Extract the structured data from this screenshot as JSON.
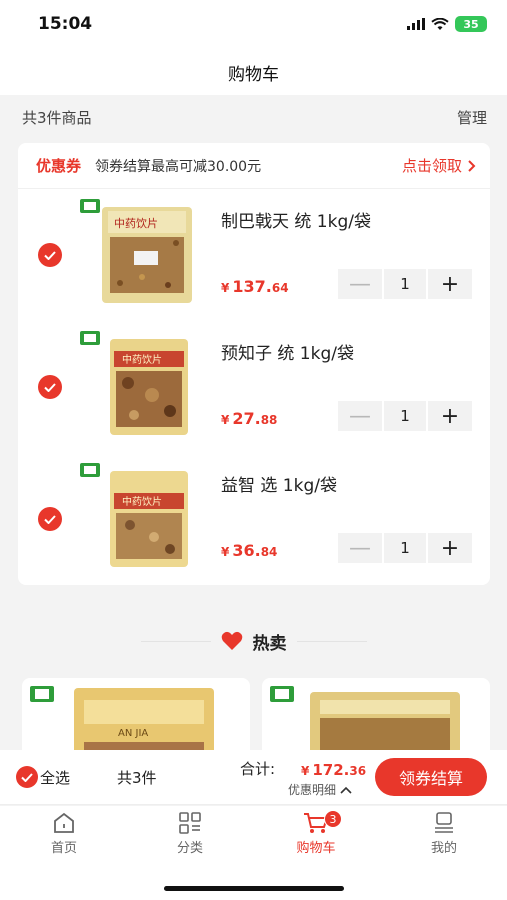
{
  "status": {
    "time": "15:04",
    "battery": "35"
  },
  "nav": {
    "title": "购物车"
  },
  "summary": {
    "count_text": "共3件商品",
    "manage": "管理"
  },
  "coupon": {
    "tag": "优惠券",
    "text": "领券结算最高可减30.00元",
    "link": "点击领取"
  },
  "items": [
    {
      "title": "制巴戟天 统 1kg/袋",
      "currency": "¥",
      "price_int": "137.",
      "price_dec": "64",
      "qty": "1",
      "selected": true
    },
    {
      "title": "预知子 统 1kg/袋",
      "currency": "¥",
      "price_int": "27.",
      "price_dec": "88",
      "qty": "1",
      "selected": true
    },
    {
      "title": "益智 选 1kg/袋",
      "currency": "¥",
      "price_int": "36.",
      "price_dec": "84",
      "qty": "1",
      "selected": true
    }
  ],
  "product_label": "中药饮片",
  "hot": {
    "title": "热卖",
    "brand": "AN JIA"
  },
  "checkout": {
    "select_all": "全选",
    "count": "共3件",
    "total_label": "合计:",
    "currency": "¥",
    "total_int": "172.",
    "total_dec": "36",
    "detail": "优惠明细",
    "pay": "领券结算"
  },
  "tabs": [
    {
      "label": "首页",
      "icon": "home-icon"
    },
    {
      "label": "分类",
      "icon": "category-icon"
    },
    {
      "label": "购物车",
      "icon": "cart-icon",
      "badge": "3",
      "active": true
    },
    {
      "label": "我的",
      "icon": "profile-icon"
    }
  ],
  "colors": {
    "accent": "#e8372b",
    "background": "#f3f3f3"
  }
}
